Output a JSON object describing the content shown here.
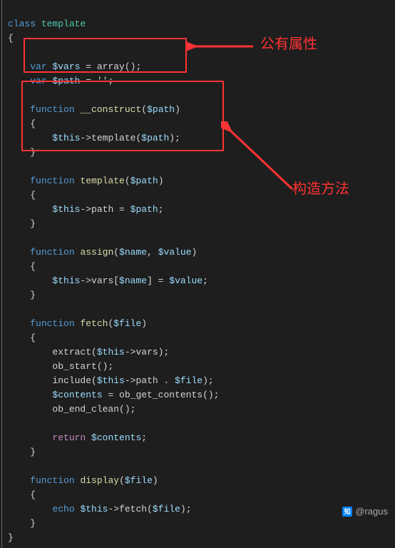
{
  "code": {
    "line1_kw": "class",
    "line1_name": "template",
    "brace_open": "{",
    "brace_close": "}",
    "var_kw": "var",
    "vars_decl_var": "$vars",
    "vars_decl_rest": " = array();",
    "path_decl_var": "$path",
    "path_decl_rest": " = '';",
    "func_kw": "function",
    "construct_name": "__construct",
    "path_param": "$path",
    "this_kw": "$this",
    "construct_body_rest": "->template(",
    "construct_body_end": ");",
    "template_name": "template",
    "template_body_rest": "->path = ",
    "template_body_end": ";",
    "assign_name": "assign",
    "name_param": "$name",
    "value_param": "$value",
    "assign_body_rest": "->vars[",
    "assign_body_mid": "] = ",
    "assign_body_end": ";",
    "fetch_name": "fetch",
    "file_param": "$file",
    "extract_call": "extract(",
    "extract_mid": "->vars);",
    "obstart_call": "ob_start();",
    "include_call": "include(",
    "include_mid": "->path . ",
    "include_end": ");",
    "contents_var": "$contents",
    "contents_rest": " = ob_get_contents();",
    "obend_call": "ob_end_clean();",
    "return_kw": "return",
    "return_end": ";",
    "display_name": "display",
    "echo_kw": "echo",
    "display_mid": "->fetch(",
    "display_end": ");"
  },
  "annotations": {
    "public_props": "公有属性",
    "constructor": "构造方法"
  },
  "watermark": {
    "text": "@ragus",
    "icon_text": "知"
  }
}
